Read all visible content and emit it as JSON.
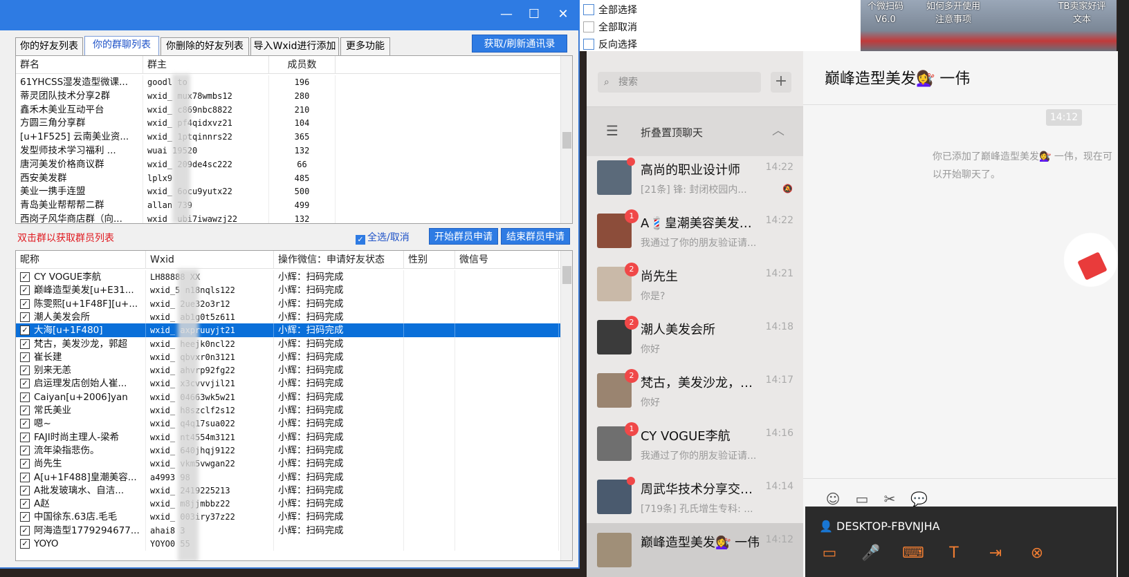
{
  "tool": {
    "window_buttons": {
      "minimize": "—",
      "maximize": "☐",
      "close": "✕"
    },
    "tabs": [
      "你的好友列表",
      "你的群聊列表",
      "你删除的好友列表",
      "导入Wxid进行添加",
      "更多功能"
    ],
    "active_tab": 1,
    "refresh_button": "获取/刷新通讯录",
    "groups": {
      "headers": [
        "群名",
        "群主",
        "成员数"
      ],
      "rows": [
        [
          "61YHCSS湿发造型微课...",
          "goodl  to",
          "196"
        ],
        [
          "蒂灵团队技术分享2群",
          "wxid_  mux78wmbs12",
          "280"
        ],
        [
          "鑫禾木美业互动平台",
          "wxid_  c869nbc8822",
          "210"
        ],
        [
          "方圆三角分享群",
          "wxid_  pf4qidxvz21",
          "104"
        ],
        [
          "[u+1F525] 云南美业资...",
          "wxid_  1ptqinnrs22",
          "365"
        ],
        [
          "发型师技术学习福利  ...",
          "wuai  19520",
          "132"
        ],
        [
          "唐河美发价格商议群",
          "wxid_  209de4sc222",
          "66"
        ],
        [
          "西安美发群",
          "lplx9",
          "485"
        ],
        [
          "美业一携手连盟",
          "wxid_  6ocu9yutx22",
          "500"
        ],
        [
          "青岛美业帮帮帮二群",
          "allan  739",
          "499"
        ],
        [
          "西岗子风华商店群（向...",
          "wxid_  ubi7iwawzj22",
          "132"
        ]
      ]
    },
    "group_hint": "双击群以获取群员列表",
    "select_all": "全选/取消",
    "start_button": "开始群员申请",
    "end_button": "结束群员申请",
    "members": {
      "headers": [
        "昵称",
        "Wxid",
        "操作微信：申请好友状态",
        "性别",
        "微信号"
      ],
      "selected_index": 4,
      "rows": [
        [
          "CY VOGUE李航",
          "LH88888  XX",
          "小辉：扫码完成"
        ],
        [
          "巅峰造型美发[u+E31...",
          "wxid_5  n18nqls122",
          "小辉：扫码完成"
        ],
        [
          "陈雯熙[u+1F48F][u+...",
          "wxid_  2ue32o3r12",
          "小辉：扫码完成"
        ],
        [
          "潮人美发会所",
          "wxid_  ab1g0t5z611",
          "小辉：扫码完成"
        ],
        [
          "大海[u+1F480]",
          "wxid_  axpruuyjt21",
          "小辉：扫码完成"
        ],
        [
          "梵古，美发沙龙，郭超",
          "wxid_  heejk0ncl22",
          "小辉：扫码完成"
        ],
        [
          "崔长建",
          "wxid_  qbvxr0n3121",
          "小辉：扫码完成"
        ],
        [
          "别来无恙",
          "wxid_  ahvrp92fg22",
          "小辉：扫码完成"
        ],
        [
          "启运理发店创始人崔...",
          "wxid_  x3cvvvjil21",
          "小辉：扫码完成"
        ],
        [
          "Caiyan[u+2006]yan",
          "wxid_  04663wk5w21",
          "小辉：扫码完成"
        ],
        [
          "常氏美业",
          "wxid_  h8szclf2s12",
          "小辉：扫码完成"
        ],
        [
          "嗯~",
          "wxid_  q4q17sua022",
          "小辉：扫码完成"
        ],
        [
          "FAJI时尚主理人-梁希",
          "wxid_  nt4554m3121",
          "小辉：扫码完成"
        ],
        [
          "流年染指悲伤。",
          "wxid_  640jhqj9122",
          "小辉：扫码完成"
        ],
        [
          "尚先生",
          "wxid_  vkm5vwgan22",
          "小辉：扫码完成"
        ],
        [
          "A[u+1F488]皇潮美容...",
          "a4993  98",
          "小辉：扫码完成"
        ],
        [
          "A批发玻璃水、自洁...",
          "wxid_  2419225213",
          "小辉：扫码完成"
        ],
        [
          "A赵",
          "wxid_  m8jjmbbz22",
          "小辉：扫码完成"
        ],
        [
          "中国徐东.63店.毛毛",
          "wxid_  003iry37z22",
          "小辉：扫码完成"
        ],
        [
          "阿海造型1779294677...",
          "ahai8  3",
          "小辉：扫码完成"
        ],
        [
          "YOYO",
          "YOYO0  55",
          ""
        ]
      ]
    }
  },
  "desktop": {
    "menu": [
      "全部选择",
      "全部取消",
      "反向选择"
    ],
    "icons": [
      {
        "line1": "个微扫码",
        "line2": "V6.0"
      },
      {
        "line1": "如何多开使用",
        "line2": "注意事项"
      },
      {
        "line1": "TB卖家好评",
        "line2": "文本"
      }
    ]
  },
  "wechat": {
    "search_placeholder": "搜索",
    "fold_label": "折叠置顶聊天",
    "conversations": [
      {
        "name": "高尚的职业设计师",
        "time": "14:22",
        "msg": "[21条] 锋: 封闭校园内...",
        "badge": "",
        "dot": true,
        "muted": true
      },
      {
        "name": "A💈皇潮美容美发创...",
        "time": "14:22",
        "msg": "我通过了你的朋友验证请...",
        "badge": "1",
        "dot": false,
        "muted": false
      },
      {
        "name": "尚先生",
        "time": "14:21",
        "msg": "你是?",
        "badge": "2",
        "dot": false,
        "muted": false
      },
      {
        "name": "潮人美发会所",
        "time": "14:18",
        "msg": "你好",
        "badge": "2",
        "dot": false,
        "muted": false
      },
      {
        "name": "梵古，美发沙龙，郭...",
        "time": "14:17",
        "msg": "你好",
        "badge": "2",
        "dot": false,
        "muted": false
      },
      {
        "name": "CY VOGUE李航",
        "time": "14:16",
        "msg": "我通过了你的朋友验证请...",
        "badge": "1",
        "dot": false,
        "muted": false
      },
      {
        "name": "周武华技术分享交流...",
        "time": "14:14",
        "msg": "[719条] 孔氏增生专科: ...",
        "badge": "",
        "dot": true,
        "muted": false
      },
      {
        "name": "巅峰造型美发💇‍♀️ 一伟",
        "time": "14:12",
        "msg": "",
        "badge": "",
        "dot": false,
        "muted": false
      }
    ],
    "chat_title": "巅峰造型美发💇‍♀️ 一伟",
    "chat_time": "14:12",
    "system_message": "你已添加了巅峰造型美发💇‍♀️ 一伟，现在可以开始聊天了。",
    "remote_device": "DESKTOP-FBVNJHA"
  },
  "colors": {
    "accent": "#2e7be3",
    "selected_row": "#0a6fd9",
    "hint_red": "#e0191f",
    "badge_red": "#f04848",
    "remote_orange": "#f07d32"
  }
}
